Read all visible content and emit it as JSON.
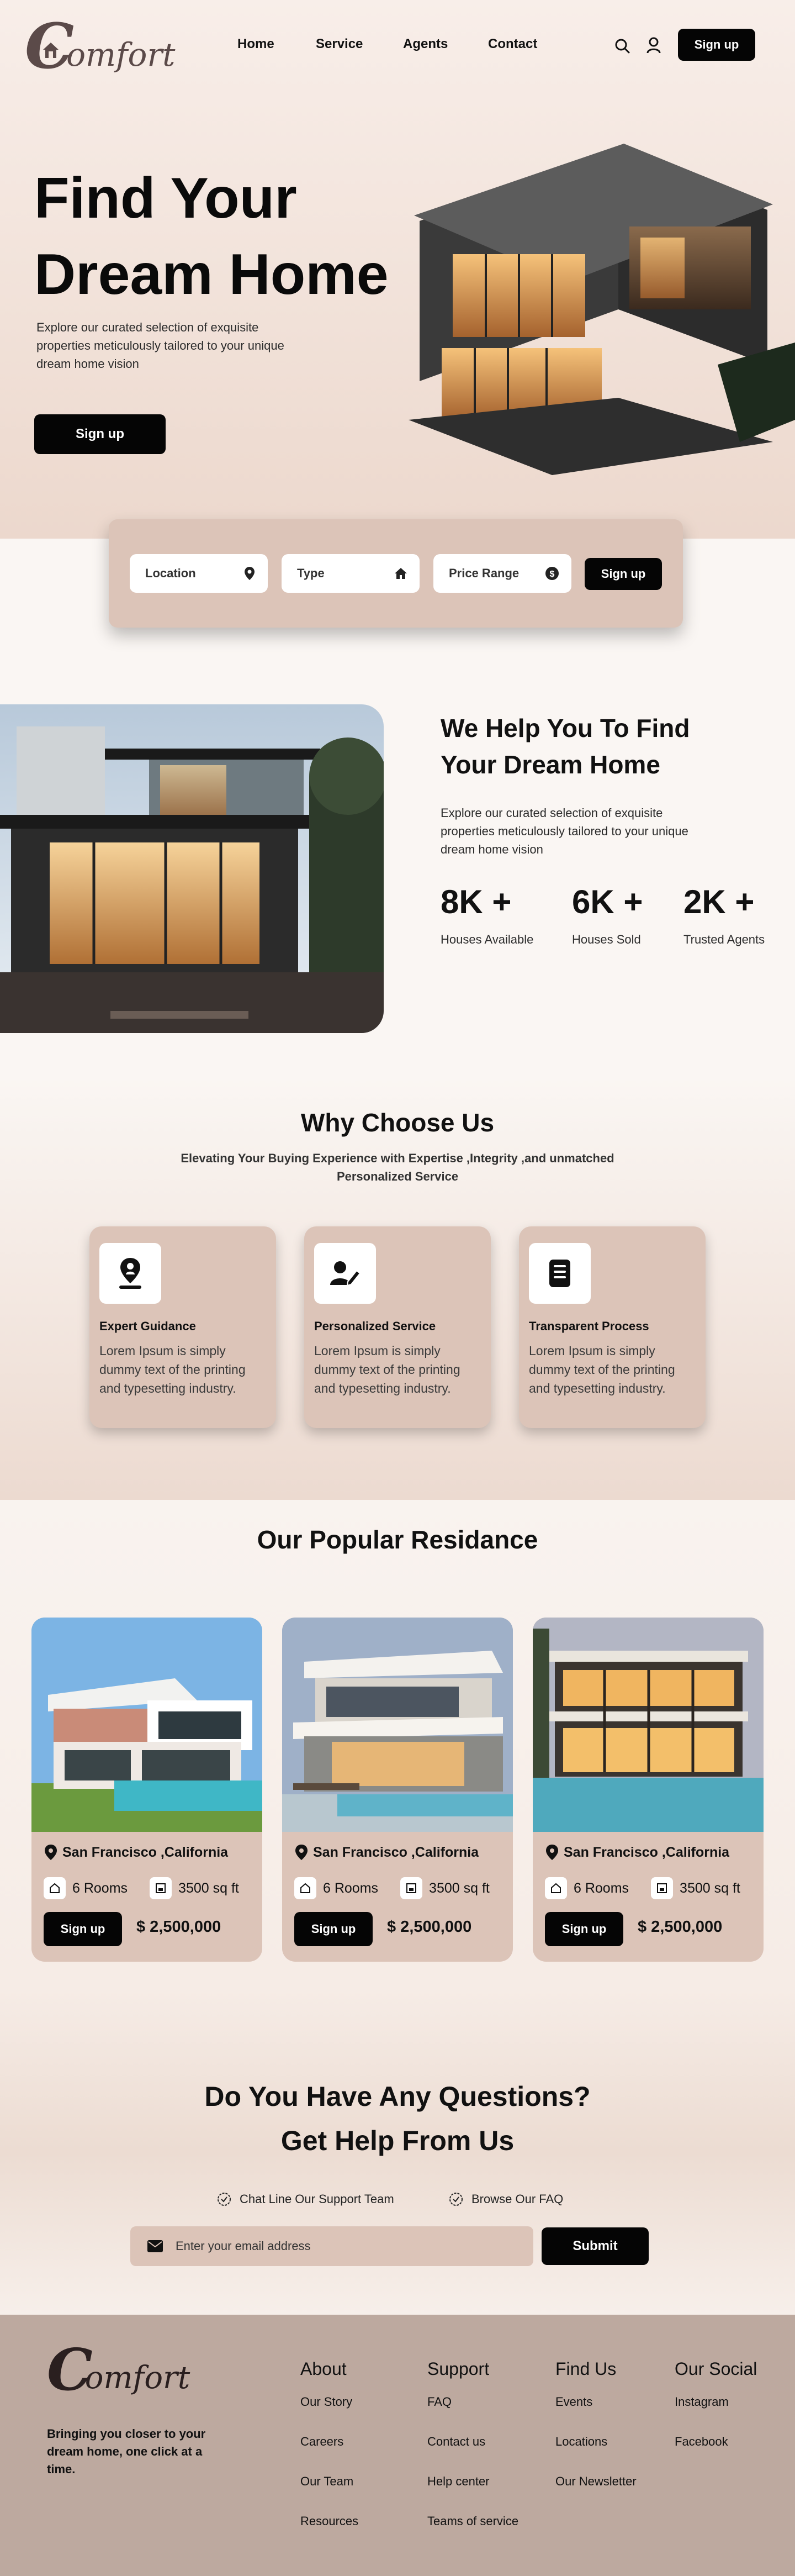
{
  "header": {
    "brand_initial": "C",
    "brand_rest": "omfort",
    "nav": [
      "Home",
      "Service",
      "Agents",
      "Contact"
    ],
    "signup_label": "Sign up"
  },
  "hero": {
    "title_line1": "Find Your",
    "title_line2": "Dream Home",
    "subtitle": "Explore our curated selection of exquisite properties meticulously tailored to your unique dream home vision",
    "cta_label": "Sign up"
  },
  "search": {
    "location": "Location",
    "type": "Type",
    "price": "Price Range",
    "button": "Sign up"
  },
  "about": {
    "title": "We Help You To Find Your Dream Home",
    "subtitle": "Explore our curated selection of exquisite properties meticulously tailored to your unique dream home vision",
    "stats": [
      {
        "value": "8K +",
        "label": "Houses Available"
      },
      {
        "value": "6K +",
        "label": "Houses Sold"
      },
      {
        "value": "2K +",
        "label": "Trusted Agents"
      }
    ]
  },
  "why": {
    "title": "Why Choose Us",
    "subtitle": "Elevating Your Buying Experience with Expertise ,Integrity ,and unmatched Personalized Service",
    "cards": [
      {
        "title": "Expert Guidance",
        "icon": "map-pin-person-icon",
        "text": "Lorem Ipsum is simply dummy text of the printing and typesetting industry."
      },
      {
        "title": "Personalized Service",
        "icon": "user-edit-icon",
        "text": "Lorem Ipsum is simply dummy text of the printing and typesetting industry."
      },
      {
        "title": "Transparent Process",
        "icon": "document-icon",
        "text": "Lorem Ipsum is simply dummy text of the printing and typesetting industry."
      }
    ]
  },
  "popular": {
    "title": "Our Popular Residance",
    "properties": [
      {
        "location": "San Francisco ,California",
        "rooms": "6 Rooms",
        "area": "3500 sq ft",
        "button": "Sign up",
        "price": "$ 2,500,000"
      },
      {
        "location": "San Francisco ,California",
        "rooms": "6 Rooms",
        "area": "3500 sq ft",
        "button": "Sign up",
        "price": "$ 2,500,000"
      },
      {
        "location": "San Francisco ,California",
        "rooms": "6 Rooms",
        "area": "3500 sq ft",
        "button": "Sign up",
        "price": "$ 2,500,000"
      }
    ]
  },
  "faq": {
    "title_line1": "Do You Have Any Questions?",
    "title_line2": "Get Help From Us",
    "link1": "Chat Line Our Support Team",
    "link2": "Browse Our FAQ",
    "email_placeholder": "Enter your email address",
    "submit": "Submit"
  },
  "footer": {
    "tagline": "Bringing you closer to your dream home, one click at a time.",
    "columns": [
      {
        "heading": "About",
        "links": [
          "Our Story",
          "Careers",
          "Our Team",
          "Resources"
        ]
      },
      {
        "heading": "Support",
        "links": [
          "FAQ",
          "Contact us",
          "Help center",
          "Teams of service"
        ]
      },
      {
        "heading": "Find Us",
        "links": [
          "Events",
          "Locations",
          "Our Newsletter"
        ]
      },
      {
        "heading": "Our Social",
        "links": [
          "Instagram",
          "Facebook"
        ]
      }
    ]
  }
}
